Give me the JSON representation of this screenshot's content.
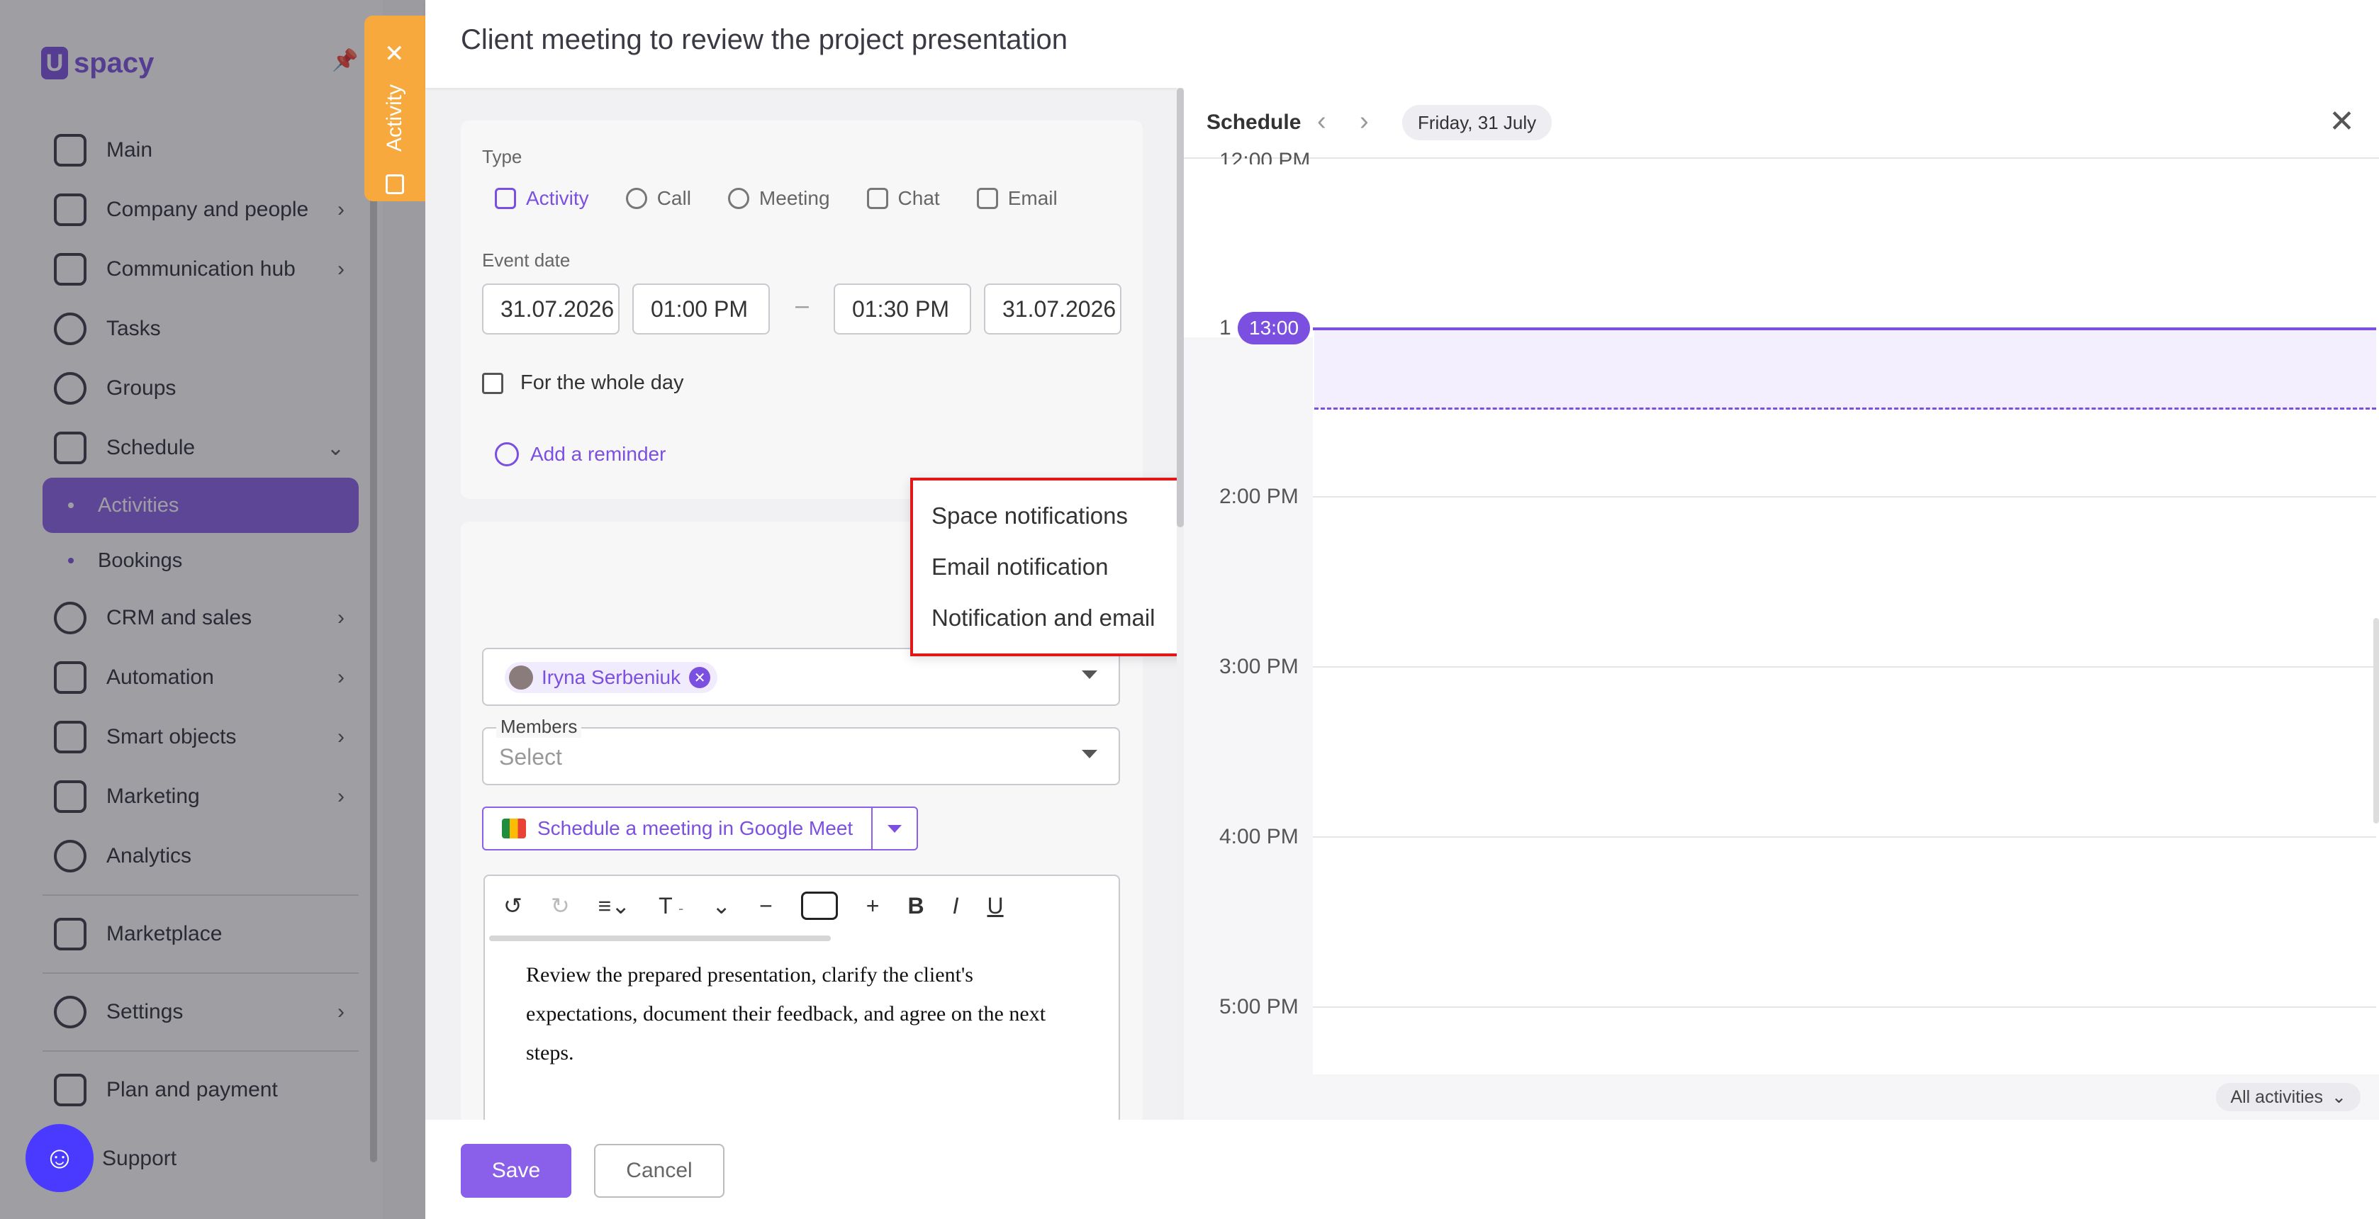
{
  "sidebar": {
    "logo_text": "spacy",
    "items": [
      {
        "label": "Main"
      },
      {
        "label": "Company and people"
      },
      {
        "label": "Communication hub"
      },
      {
        "label": "Tasks"
      },
      {
        "label": "Groups"
      },
      {
        "label": "Schedule"
      }
    ],
    "sub_items": [
      {
        "label": "Activities"
      },
      {
        "label": "Bookings"
      }
    ],
    "items2": [
      {
        "label": "CRM and sales"
      },
      {
        "label": "Automation"
      },
      {
        "label": "Smart objects"
      },
      {
        "label": "Marketing"
      },
      {
        "label": "Analytics"
      }
    ],
    "marketplace": "Marketplace",
    "settings": "Settings",
    "plan": "Plan and payment",
    "support": "Support"
  },
  "activity_tab": {
    "label": "Activity"
  },
  "panel": {
    "title": "Client meeting to review the project presentation"
  },
  "form": {
    "type_label": "Type",
    "types": [
      "Activity",
      "Call",
      "Meeting",
      "Chat",
      "Email"
    ],
    "event_date_label": "Event date",
    "start_date": "31.07.2026",
    "start_time": "01:00 PM",
    "end_time": "01:30 PM",
    "end_date": "31.07.2026",
    "dash": "–",
    "whole_day": "For the whole day",
    "add_reminder": "Add a reminder",
    "reminder_options": [
      "Space notifications",
      "Email notification",
      "Notification and email"
    ],
    "responsible": "Iryna Serbeniuk",
    "members_label": "Members",
    "members_placeholder": "Select",
    "gmeet": "Schedule a meeting in Google Meet",
    "editor_text": "Review the prepared presentation, clarify the client's expectations, document their feedback, and agree on the next steps.",
    "toolbar_dash": "-"
  },
  "footer": {
    "save": "Save",
    "cancel": "Cancel"
  },
  "schedule": {
    "title": "Schedule",
    "date": "Friday, 31 July",
    "times": [
      "12:00 PM",
      "1",
      "2:00 PM",
      "3:00 PM",
      "4:00 PM",
      "5:00 PM"
    ],
    "now": "13:00",
    "all_activities": "All activities"
  },
  "colors": {
    "accent": "#7b4fe0",
    "highlight": "#e01818",
    "activity_tab": "#f7a93d"
  }
}
